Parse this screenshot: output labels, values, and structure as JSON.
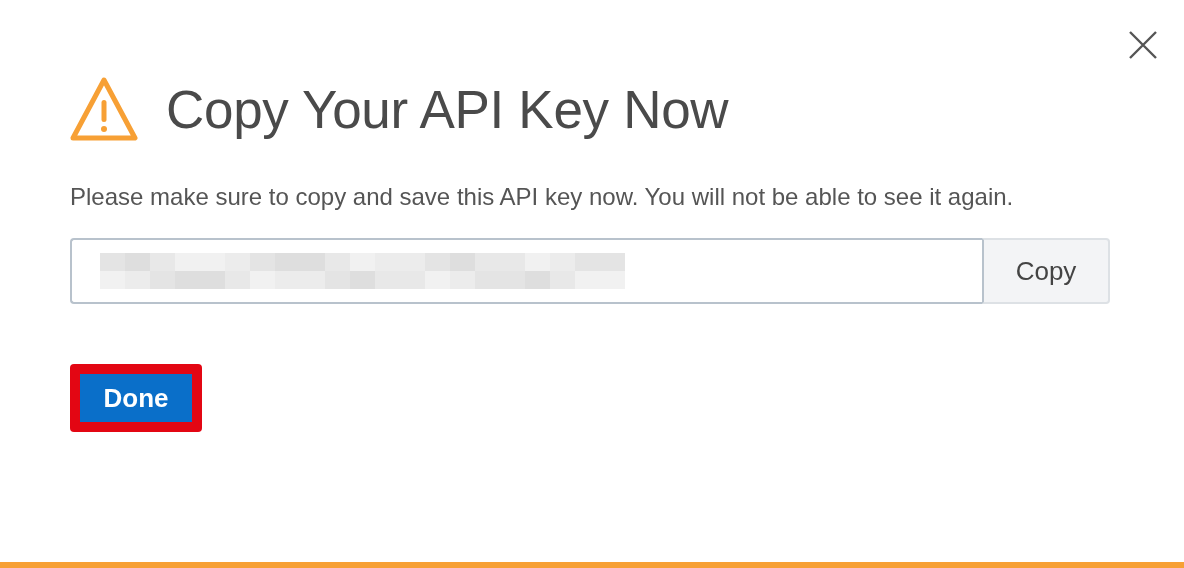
{
  "dialog": {
    "title": "Copy Your API Key Now",
    "message": "Please make sure to copy and save this API key now. You will not be able to see it again.",
    "key_field": {
      "redacted": true
    },
    "copy_button": "Copy",
    "done_button": {
      "label": "Done",
      "highlighted": true
    }
  }
}
